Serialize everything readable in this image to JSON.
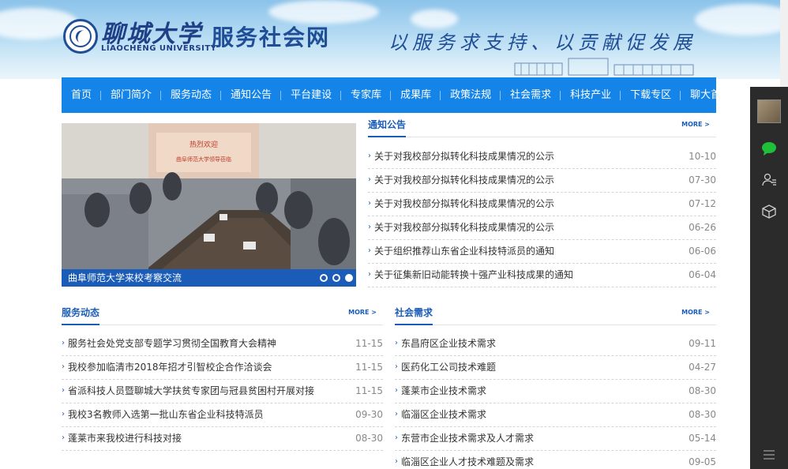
{
  "header": {
    "university_cn": "聊城大学",
    "university_en": "LIAOCHENG UNIVERSITY",
    "site_name": "服务社会网",
    "slogan": "以服务求支持、以贡献促发展"
  },
  "nav": {
    "items": [
      "首页",
      "部门简介",
      "服务动态",
      "通知公告",
      "平台建设",
      "专家库",
      "成果库",
      "政策法规",
      "社会需求",
      "科技产业",
      "下载专区",
      "聊大首页"
    ]
  },
  "slider": {
    "caption": "曲阜师范大学来校考察交流",
    "welcome_text": "热烈欢迎",
    "welcome_sub": "曲阜师范大学领导莅临",
    "dots": 3,
    "active_dot": 3
  },
  "notices": {
    "title": "通知公告",
    "more": "MORE >",
    "items": [
      {
        "title": "关于对我校部分拟转化科技成果情况的公示",
        "date": "10-10"
      },
      {
        "title": "关于对我校部分拟转化科技成果情况的公示",
        "date": "07-30"
      },
      {
        "title": "关于对我校部分拟转化科技成果情况的公示",
        "date": "07-12"
      },
      {
        "title": "关于对我校部分拟转化科技成果情况的公示",
        "date": "06-26"
      },
      {
        "title": "关于组织推荐山东省企业科技特派员的通知",
        "date": "06-06"
      },
      {
        "title": "关于征集新旧动能转换十强产业科技成果的通知",
        "date": "06-04"
      }
    ]
  },
  "news": {
    "title": "服务动态",
    "more": "MORE >",
    "items": [
      {
        "title": "服务社会处党支部专题学习贯彻全国教育大会精神",
        "date": "11-15"
      },
      {
        "title": "我校参加临清市2018年招才引智校企合作洽谈会",
        "date": "11-15"
      },
      {
        "title": "省派科技人员暨聊城大学扶贫专家团与冠县贫困村开展对接",
        "date": "11-15"
      },
      {
        "title": "我校3名教师入选第一批山东省企业科技特派员",
        "date": "09-30"
      },
      {
        "title": "蓬莱市来我校进行科技对接",
        "date": "08-30"
      }
    ]
  },
  "demands": {
    "title": "社会需求",
    "more": "MORE >",
    "items": [
      {
        "title": "东昌府区企业技术需求",
        "date": "09-11"
      },
      {
        "title": "医药化工公司技术难题",
        "date": "04-27"
      },
      {
        "title": "蓬莱市企业技术需求",
        "date": "08-30"
      },
      {
        "title": "临淄区企业技术需求",
        "date": "08-30"
      },
      {
        "title": "东营市企业技术需求及人才需求",
        "date": "05-14"
      },
      {
        "title": "临淄区企业人才技术难题及需求",
        "date": "09-05"
      }
    ]
  },
  "sidebar": {
    "icons": [
      "avatar",
      "chat-icon",
      "user-list-icon",
      "cube-icon",
      "menu-icon"
    ]
  }
}
